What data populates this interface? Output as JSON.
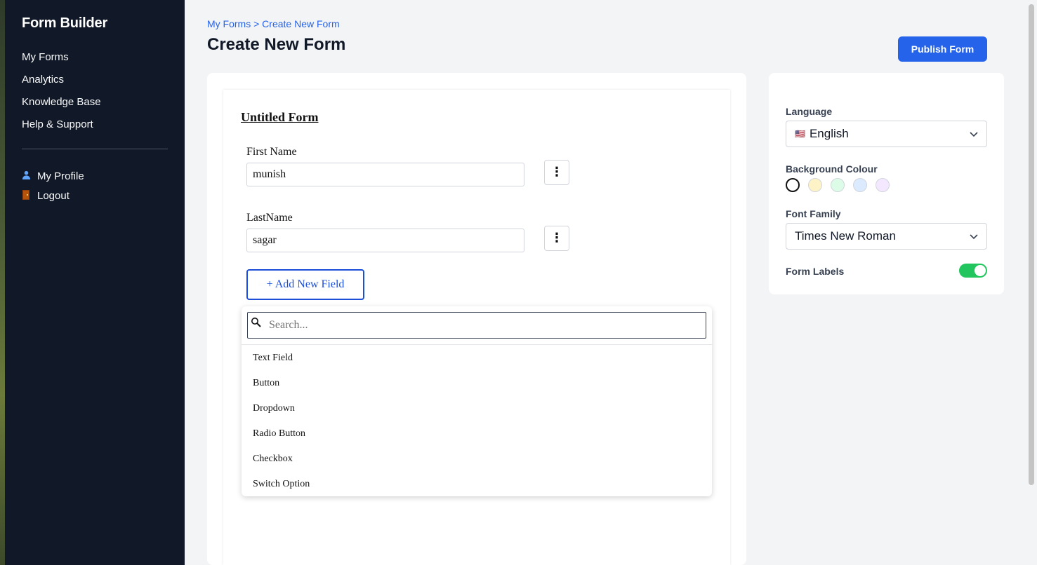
{
  "sidebar": {
    "brand": "Form Builder",
    "nav": [
      "My Forms",
      "Analytics",
      "Knowledge Base",
      "Help & Support"
    ],
    "profile_label": "My Profile",
    "logout_label": "Logout"
  },
  "header": {
    "breadcrumb": "My Forms > Create New Form",
    "title": "Create New Form",
    "publish_label": "Publish Form"
  },
  "form": {
    "title": "Untitled Form",
    "fields": [
      {
        "label": "First Name",
        "value": "munish"
      },
      {
        "label": "LastName",
        "value": "sagar"
      }
    ],
    "add_field_label": "+ Add New Field"
  },
  "field_menu": {
    "search_placeholder": "Search...",
    "items": [
      "Text Field",
      "Button",
      "Dropdown",
      "Radio Button",
      "Checkbox",
      "Switch Option"
    ]
  },
  "settings": {
    "language_label": "Language",
    "language_value": "English",
    "language_flag": "🇺🇸",
    "background_label": "Background Colour",
    "swatches": [
      "#ffffff",
      "#fef3c7",
      "#dcfce7",
      "#dbeafe",
      "#f3e8ff"
    ],
    "font_family_label": "Font Family",
    "font_family_value": "Times New Roman",
    "form_labels_label": "Form Labels",
    "form_labels_on": true,
    "toggle_color": "#22c55e"
  },
  "colors": {
    "accent": "#2563eb",
    "sidebar_bg": "#111827"
  }
}
